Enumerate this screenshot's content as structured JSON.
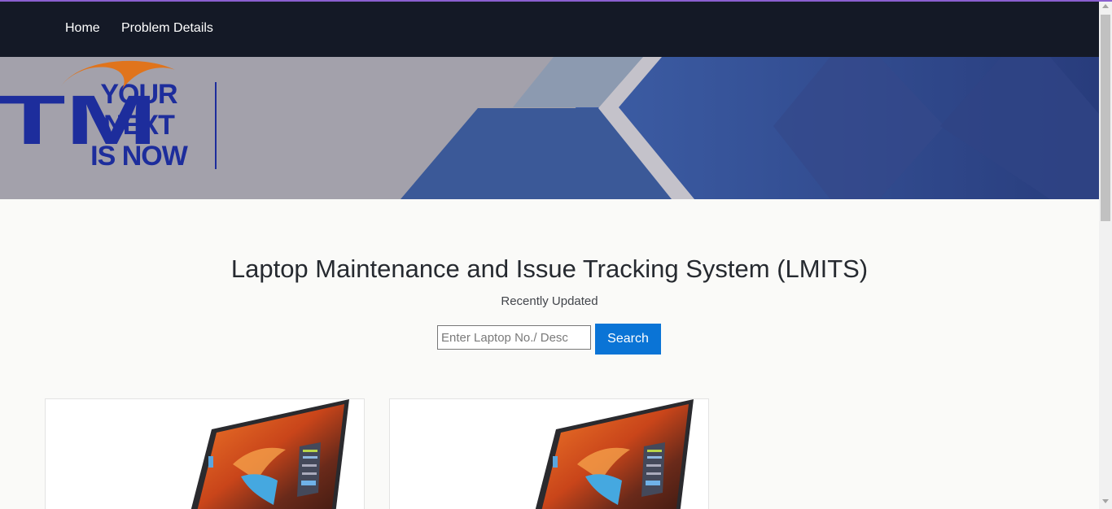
{
  "nav": {
    "links": [
      {
        "label": "Home"
      },
      {
        "label": "Problem Details"
      }
    ]
  },
  "banner": {
    "slogan_lines": [
      "YOUR",
      "NEXT",
      "IS NOW"
    ],
    "logo_text": "TM",
    "brand_color": "#1d2d9c",
    "accent_color": "#e0741c"
  },
  "main": {
    "title": "Laptop Maintenance and Issue Tracking System (LMITS)",
    "subtitle": "Recently Updated",
    "search": {
      "placeholder": "Enter Laptop No./ Desc",
      "value": "",
      "button_label": "Search"
    },
    "cards": [
      {
        "image": "laptop-image"
      },
      {
        "image": "laptop-image"
      }
    ]
  },
  "colors": {
    "navbar": "#141926",
    "button": "#0a74d6",
    "top_accent": "#8a5fd0"
  }
}
